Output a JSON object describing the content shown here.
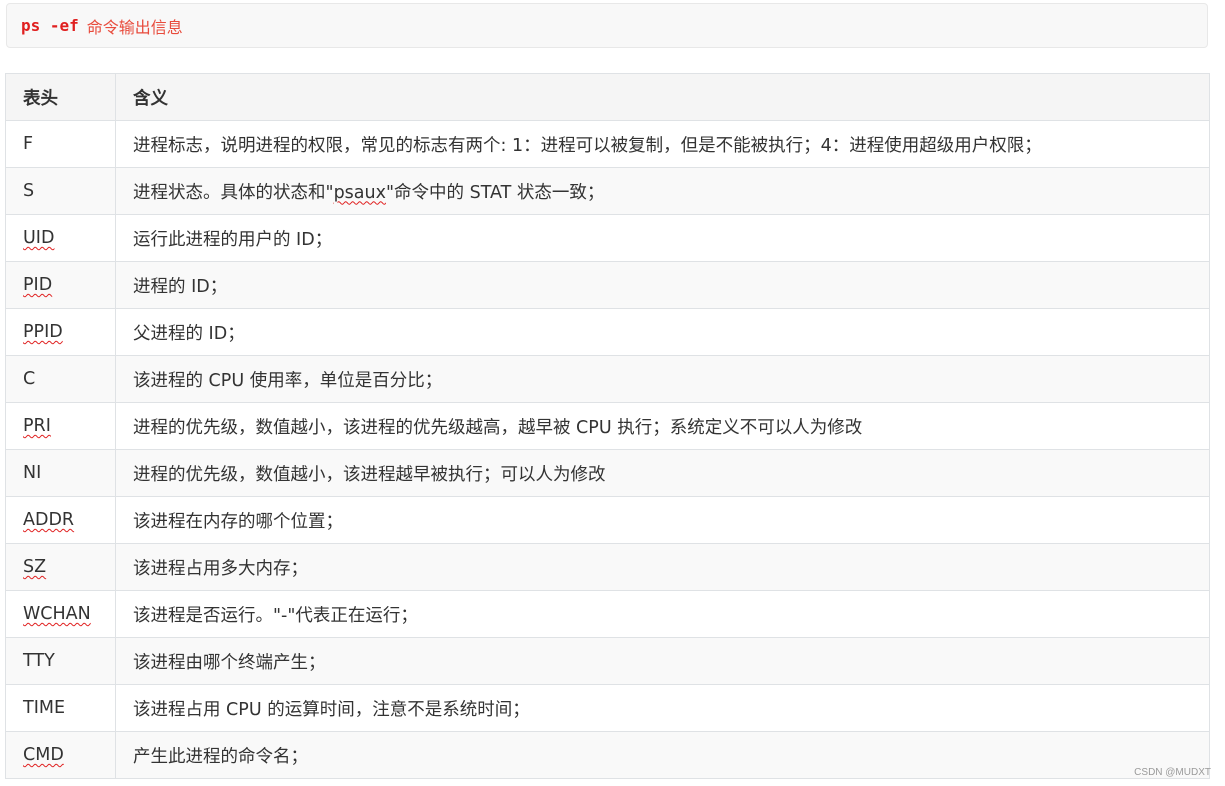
{
  "code": {
    "command": "ps -ef",
    "comment": "命令输出信息"
  },
  "table": {
    "headers": [
      "表头",
      "含义"
    ],
    "rows": [
      {
        "field": "F",
        "meaning": "进程标志，说明进程的权限，常见的标志有两个: 1：进程可以被复制，但是不能被执行；4：进程使用超级用户权限；"
      },
      {
        "field": "S",
        "meaning_pre": "进程状态。具体的状态和\"",
        "meaning_mark": "psaux",
        "meaning_post": "\"命令中的 STAT 状态一致；"
      },
      {
        "field": "UID",
        "meaning": "运行此进程的用户的 ID；"
      },
      {
        "field": "PID",
        "meaning": "进程的 ID；"
      },
      {
        "field": "PPID",
        "meaning": "父进程的 ID；"
      },
      {
        "field": "C",
        "meaning": "该进程的 CPU 使用率，单位是百分比；"
      },
      {
        "field": "PRI",
        "meaning": "进程的优先级，数值越小，该进程的优先级越高，越早被 CPU 执行；系统定义不可以人为修改"
      },
      {
        "field": "NI",
        "meaning": "进程的优先级，数值越小，该进程越早被执行；可以人为修改"
      },
      {
        "field": "ADDR",
        "meaning": "该进程在内存的哪个位置；"
      },
      {
        "field": "SZ",
        "meaning": "该进程占用多大内存；"
      },
      {
        "field": "WCHAN",
        "meaning": "该进程是否运行。\"-\"代表正在运行；"
      },
      {
        "field": "TTY",
        "meaning": "该进程由哪个终端产生；"
      },
      {
        "field": "TIME",
        "meaning": "该进程占用 CPU 的运算时间，注意不是系统时间；"
      },
      {
        "field": "CMD",
        "meaning": "产生此进程的命令名；"
      }
    ]
  },
  "watermark": "CSDN @MUDXT"
}
